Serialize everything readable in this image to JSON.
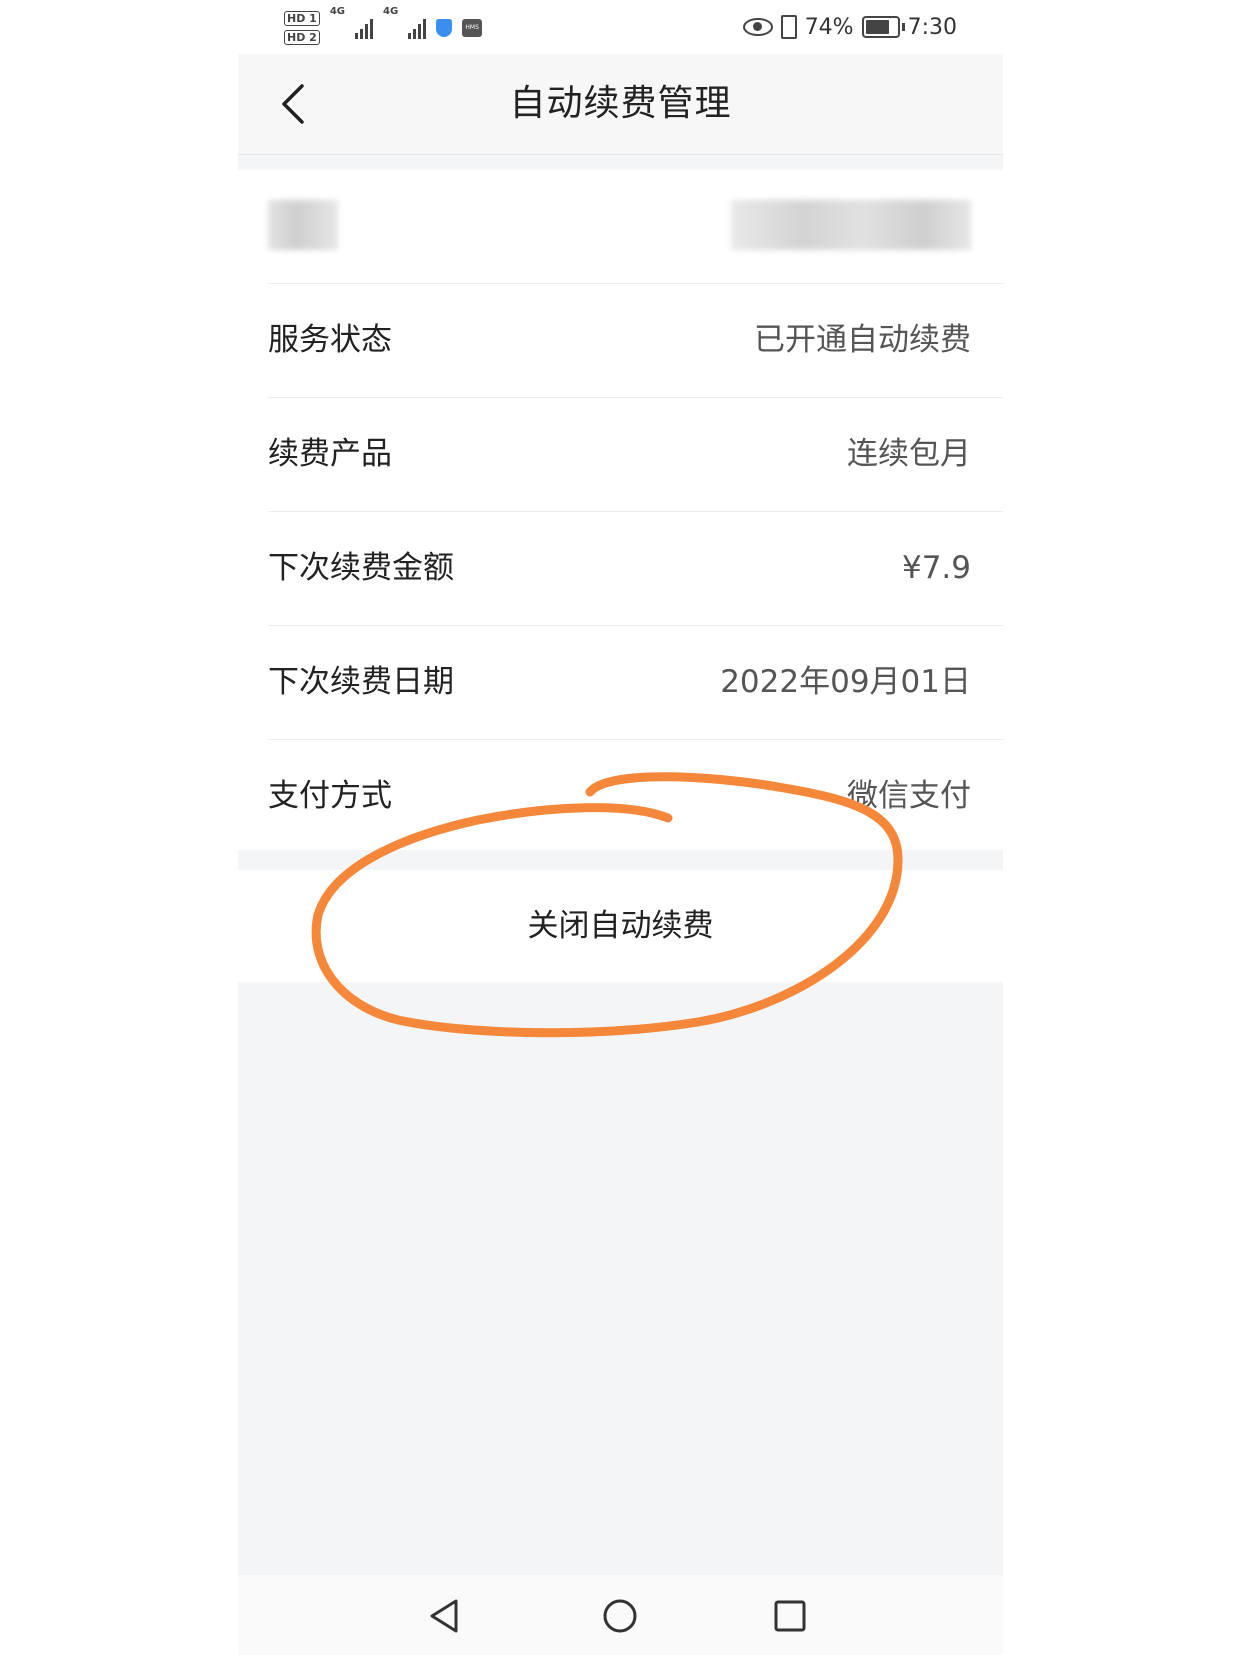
{
  "status_bar": {
    "net_type_1": "4G",
    "net_type_2": "4G",
    "battery_percent": "74%",
    "time": "7:30",
    "sim_1": "HD 1",
    "sim_2": "HD 2",
    "hms_badge": "HMS"
  },
  "header": {
    "title": "自动续费管理"
  },
  "details": {
    "service_status_label": "服务状态",
    "service_status_value": "已开通自动续费",
    "product_label": "续费产品",
    "product_value": "连续包月",
    "next_amount_label": "下次续费金额",
    "next_amount_value": "¥7.9",
    "next_date_label": "下次续费日期",
    "next_date_value": "2022年09月01日",
    "payment_label": "支付方式",
    "payment_value": "微信支付"
  },
  "actions": {
    "close_auto_renew": "关闭自动续费"
  },
  "colors": {
    "annotation": "#f5873a",
    "background": "#f4f5f7"
  },
  "icons": [
    "back-arrow-icon",
    "eye-icon",
    "vibrate-icon",
    "battery-icon",
    "nav-back-icon",
    "nav-home-icon",
    "nav-recents-icon"
  ]
}
